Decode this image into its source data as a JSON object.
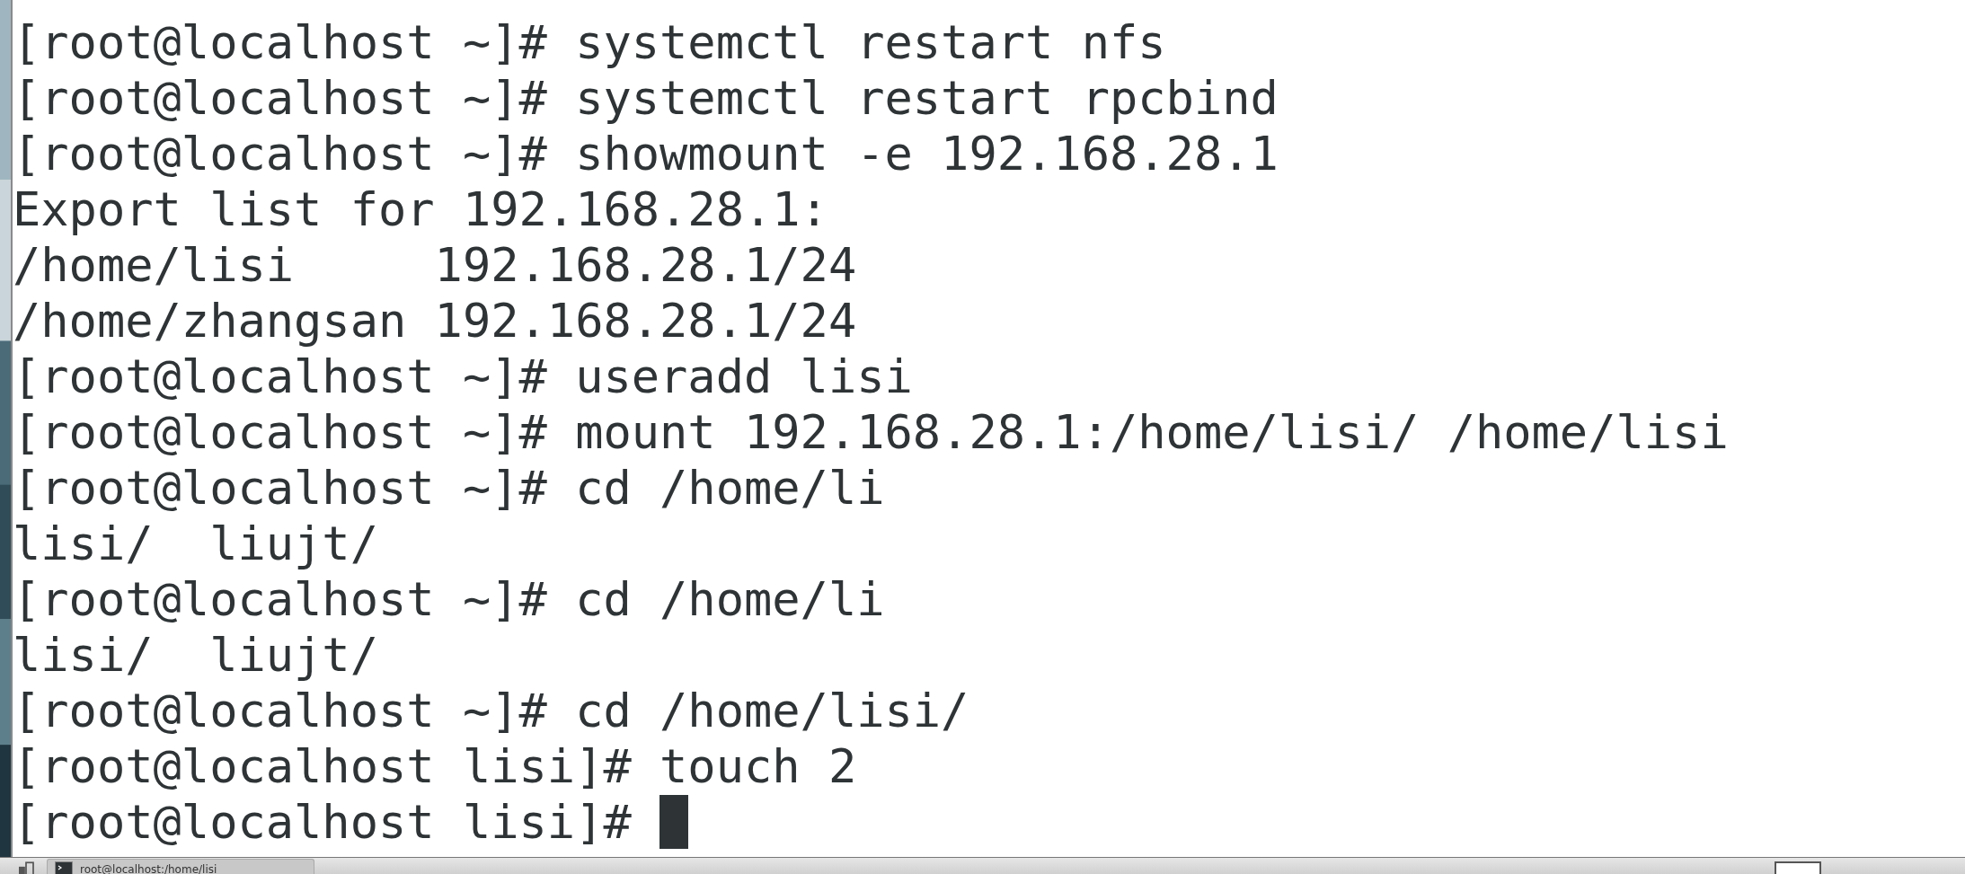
{
  "terminal": {
    "lines": [
      "[root@localhost ~]# systemctl restart nfs",
      "[root@localhost ~]# systemctl restart rpcbind",
      "[root@localhost ~]# showmount -e 192.168.28.1",
      "Export list for 192.168.28.1:",
      "/home/lisi     192.168.28.1/24",
      "/home/zhangsan 192.168.28.1/24",
      "[root@localhost ~]# useradd lisi",
      "[root@localhost ~]# mount 192.168.28.1:/home/lisi/ /home/lisi",
      "[root@localhost ~]# cd /home/li",
      "lisi/  liujt/",
      "[root@localhost ~]# cd /home/li",
      "lisi/  liujt/",
      "[root@localhost ~]# cd /home/lisi/",
      "[root@localhost lisi]# touch 2",
      "[root@localhost lisi]# "
    ],
    "cursor_visible": true
  },
  "taskbar": {
    "tasks": [
      {
        "label": "root@localhost:/home/lisi",
        "selected": true
      }
    ]
  }
}
